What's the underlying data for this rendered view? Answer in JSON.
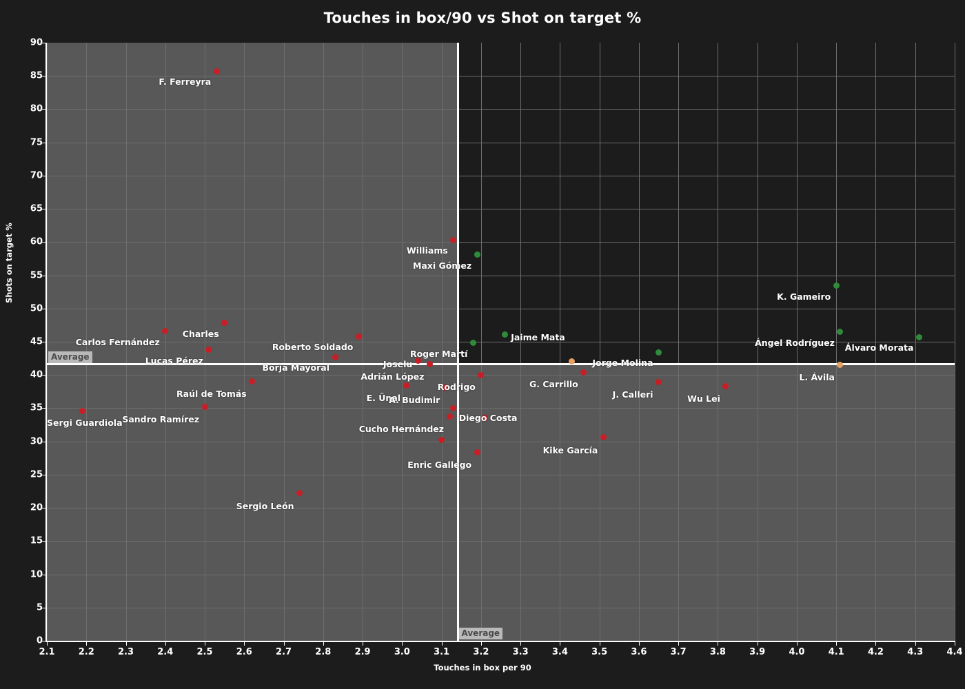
{
  "chart_data": {
    "type": "scatter",
    "title": "Touches in box/90 vs Shot on target %",
    "xlabel": "Touches in box per 90",
    "ylabel": "Shots on target %",
    "xlim": [
      2.1,
      4.4
    ],
    "ylim": [
      0,
      90
    ],
    "xticks": [
      "2.1",
      "2.2",
      "2.3",
      "2.4",
      "2.5",
      "2.6",
      "2.7",
      "2.8",
      "2.9",
      "3.0",
      "3.1",
      "3.2",
      "3.3",
      "3.4",
      "3.5",
      "3.6",
      "3.7",
      "3.8",
      "3.9",
      "4.0",
      "4.1",
      "4.2",
      "4.3",
      "4.4"
    ],
    "yticks": [
      "0",
      "5",
      "10",
      "15",
      "20",
      "25",
      "30",
      "35",
      "40",
      "45",
      "50",
      "55",
      "60",
      "65",
      "70",
      "75",
      "80",
      "85",
      "90"
    ],
    "grid": true,
    "legend_position": "none",
    "average_lines": {
      "x_average_value": 3.14,
      "y_average_value": 41.7,
      "x_average_label": "Average",
      "y_average_label": "Average"
    },
    "colors": {
      "point_red": "#c81e26",
      "point_green": "#2e8b3a",
      "point_orange": "#e8a163",
      "background": "#1c1c1c",
      "plot_background": "#585858",
      "quadrant_highlight": "#1c1c1c",
      "axis": "#ffffff",
      "grid": "#6e6e6e",
      "average_line": "#ffffff",
      "average_tag_bg": "#b9b9b9"
    },
    "points": [
      {
        "label": "F. Ferreyra",
        "x": 2.53,
        "y": 85.7,
        "color": "#c81e26",
        "label_dx": -8,
        "label_dy": 15,
        "label_align": "right"
      },
      {
        "label": "Williams",
        "x": 3.13,
        "y": 60.3,
        "color": "#c81e26",
        "label_dx": -8,
        "label_dy": 15,
        "label_align": "right"
      },
      {
        "label": "Maxi Gómez",
        "x": 3.19,
        "y": 58.1,
        "color": "#2e8b3a",
        "label_dx": -8,
        "label_dy": 15,
        "label_align": "right"
      },
      {
        "label": "K. Gameiro",
        "x": 4.1,
        "y": 53.4,
        "color": "#2e8b3a",
        "label_dx": -8,
        "label_dy": 15,
        "label_align": "right"
      },
      {
        "label": "Charles",
        "x": 2.55,
        "y": 47.8,
        "color": "#c81e26",
        "label_dx": -8,
        "label_dy": 15,
        "label_align": "right"
      },
      {
        "label": "Carlos Fernández",
        "x": 2.4,
        "y": 46.6,
        "color": "#c81e26",
        "label_dx": -8,
        "label_dy": 15,
        "label_align": "right"
      },
      {
        "label": "Ángel Rodríguez",
        "x": 4.11,
        "y": 46.5,
        "color": "#2e8b3a",
        "label_dx": -8,
        "label_dy": 15,
        "label_align": "right"
      },
      {
        "label": "Jaime Mata",
        "x": 3.26,
        "y": 46.1,
        "color": "#2e8b3a",
        "label_dx": 9,
        "label_dy": 4,
        "label_align": "left"
      },
      {
        "label": "Roberto Soldado",
        "x": 2.89,
        "y": 45.8,
        "color": "#c81e26",
        "label_dx": -8,
        "label_dy": 15,
        "label_align": "right"
      },
      {
        "label": "Álvaro Morata",
        "x": 4.31,
        "y": 45.7,
        "color": "#2e8b3a",
        "label_dx": -8,
        "label_dy": 15,
        "label_align": "right"
      },
      {
        "label": "Roger Martí",
        "x": 3.18,
        "y": 44.8,
        "color": "#2e8b3a",
        "label_dx": -8,
        "label_dy": 15,
        "label_align": "right"
      },
      {
        "label": "Lucas Pérez",
        "x": 2.51,
        "y": 43.8,
        "color": "#c81e26",
        "label_dx": -8,
        "label_dy": 15,
        "label_align": "right"
      },
      {
        "label": "Jorge Molina",
        "x": 3.65,
        "y": 43.4,
        "color": "#2e8b3a",
        "label_dx": -8,
        "label_dy": 15,
        "label_align": "right"
      },
      {
        "label": "Borja Mayoral",
        "x": 2.83,
        "y": 42.7,
        "color": "#c81e26",
        "label_dx": -8,
        "label_dy": 15,
        "label_align": "right"
      },
      {
        "label": "Joselu",
        "x": 3.04,
        "y": 42.1,
        "color": "#c81e26",
        "label_dx": -8,
        "label_dy": 4,
        "label_align": "right"
      },
      {
        "label": "",
        "x": 3.43,
        "y": 42.0,
        "color": "#e8a163",
        "label_dx": 0,
        "label_dy": 0,
        "label_align": "left"
      },
      {
        "label": "Adrián López",
        "x": 3.07,
        "y": 41.6,
        "color": "#c81e26",
        "label_dx": -8,
        "label_dy": 17,
        "label_align": "right"
      },
      {
        "label": "L. Ávila",
        "x": 4.11,
        "y": 41.5,
        "color": "#e8a163",
        "label_dx": -8,
        "label_dy": 17,
        "label_align": "right"
      },
      {
        "label": "G. Carrillo",
        "x": 3.46,
        "y": 40.4,
        "color": "#c81e26",
        "label_dx": -8,
        "label_dy": 17,
        "label_align": "right"
      },
      {
        "label": "Rodrigo",
        "x": 3.2,
        "y": 40.0,
        "color": "#c81e26",
        "label_dx": -8,
        "label_dy": 17,
        "label_align": "right"
      },
      {
        "label": "Raúl de Tomás",
        "x": 2.62,
        "y": 39.0,
        "color": "#c81e26",
        "label_dx": -8,
        "label_dy": 17,
        "label_align": "right"
      },
      {
        "label": "J. Calleri",
        "x": 3.65,
        "y": 38.9,
        "color": "#c81e26",
        "label_dx": -8,
        "label_dy": 17,
        "label_align": "right"
      },
      {
        "label": "E. Ünal",
        "x": 3.01,
        "y": 38.4,
        "color": "#c81e26",
        "label_dx": -8,
        "label_dy": 17,
        "label_align": "right"
      },
      {
        "label": "Wu Lei",
        "x": 3.82,
        "y": 38.3,
        "color": "#c81e26",
        "label_dx": -8,
        "label_dy": 17,
        "label_align": "right"
      },
      {
        "label": "A. Budimir",
        "x": 3.11,
        "y": 38.1,
        "color": "#c81e26",
        "label_dx": -8,
        "label_dy": 17,
        "label_align": "right"
      },
      {
        "label": "Diego Costa",
        "x": 3.13,
        "y": 35.0,
        "color": "#c81e26",
        "label_dx": 8,
        "label_dy": 14,
        "label_align": "left"
      },
      {
        "label": "Sandro Ramírez",
        "x": 2.5,
        "y": 35.2,
        "color": "#c81e26",
        "label_dx": -8,
        "label_dy": 17,
        "label_align": "right"
      },
      {
        "label": "Sergi Guardiola",
        "x": 2.19,
        "y": 34.6,
        "color": "#c81e26",
        "label_dx": -8,
        "label_dy": 17,
        "label_align": "right"
      },
      {
        "label": "Cucho Hernández",
        "x": 3.12,
        "y": 33.8,
        "color": "#c81e26",
        "label_dx": -8,
        "label_dy": 18,
        "label_align": "right"
      },
      {
        "label": "",
        "x": 3.21,
        "y": 33.5,
        "color": "#c81e26",
        "label_dx": 0,
        "label_dy": 0,
        "label_align": "left"
      },
      {
        "label": "Kike García",
        "x": 3.51,
        "y": 30.6,
        "color": "#c81e26",
        "label_dx": -8,
        "label_dy": 18,
        "label_align": "right"
      },
      {
        "label": "",
        "x": 3.1,
        "y": 30.2,
        "color": "#c81e26",
        "label_dx": 0,
        "label_dy": 0,
        "label_align": "left"
      },
      {
        "label": "Enric Gallego",
        "x": 3.19,
        "y": 28.4,
        "color": "#c81e26",
        "label_dx": -8,
        "label_dy": 18,
        "label_align": "right"
      },
      {
        "label": "Sergio León",
        "x": 2.74,
        "y": 22.2,
        "color": "#c81e26",
        "label_dx": -8,
        "label_dy": 18,
        "label_align": "right"
      }
    ]
  }
}
